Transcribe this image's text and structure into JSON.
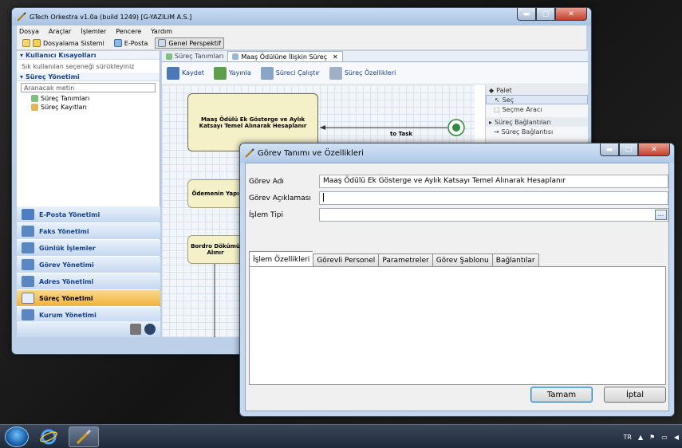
{
  "main_window": {
    "title": "GTech Orkestra v1.0a (build 1249) [G-YAZILIM A.S.]",
    "menu": [
      "Dosya",
      "Araçlar",
      "İşlemler",
      "Pencere",
      "Yardım"
    ],
    "perspectives": [
      {
        "label": "Dosyalama Sistemi",
        "icon": "folder-icon"
      },
      {
        "label": "E-Posta",
        "icon": "email-icon"
      },
      {
        "label": "Genel Perspektif",
        "icon": "perspective-icon"
      }
    ],
    "left": {
      "shortcuts_title": "Kullanıcı Kısayolları",
      "shortcuts_hint": "Sık kullanılan seçeneği sürükleyiniz",
      "process_title": "Süreç Yönetimi",
      "search_placeholder": "Aranacak metin",
      "tree": [
        "Süreç Tanımları",
        "Süreç Kayıtları"
      ],
      "nav": [
        {
          "label": "E-Posta Yönetimi",
          "icon": "email-icon"
        },
        {
          "label": "Faks Yönetimi",
          "icon": "fax-icon"
        },
        {
          "label": "Günlük İşlemler",
          "icon": "daily-icon"
        },
        {
          "label": "Görev Yönetimi",
          "icon": "task-icon"
        },
        {
          "label": "Adres Yönetimi",
          "icon": "address-icon"
        },
        {
          "label": "Süreç Yönetimi",
          "icon": "process-icon"
        },
        {
          "label": "Kurum Yönetimi",
          "icon": "organization-icon"
        }
      ]
    },
    "editor": {
      "tabs": [
        "Süreç Tanımları",
        "Maaş Ödülüne İlişkin Süreç"
      ],
      "toolbar": [
        "Kaydet",
        "Yayınla",
        "Süreci Çalıştır",
        "Süreç Özellikleri"
      ],
      "nodes": [
        "Maaş Ödülü Ek Gösterge ve Aylık Katsayı Temel Alınarak Hesaplanır",
        "Ödemenin Yapı",
        "Bordro Dökümü Alınır"
      ],
      "transition_label": "to Task",
      "palette": {
        "title": "Palet",
        "items": [
          "Seç",
          "Seçme Aracı"
        ],
        "section": "Süreç Bağlantıları",
        "section_items": [
          "Süreç Bağlantısı"
        ]
      }
    }
  },
  "dialog": {
    "title": "Görev Tanımı ve Özellikleri",
    "fields": {
      "task_name_label": "Görev Adı",
      "task_name_value": "Maaş Ödülü Ek Gösterge ve Aylık Katsayı Temel Alınarak Hesaplanır",
      "desc_label": "Görev Açıklaması",
      "desc_value": "",
      "type_label": "İşlem Tipi",
      "type_value": "",
      "browse_label": "..."
    },
    "tabs": [
      "İşlem Özellikleri",
      "Görevli Personel",
      "Parametreler",
      "Görev Şablonu",
      "Bağlantılar"
    ],
    "ok_label": "Tamam",
    "cancel_label": "İptal"
  },
  "taskbar": {
    "language": "TR"
  }
}
